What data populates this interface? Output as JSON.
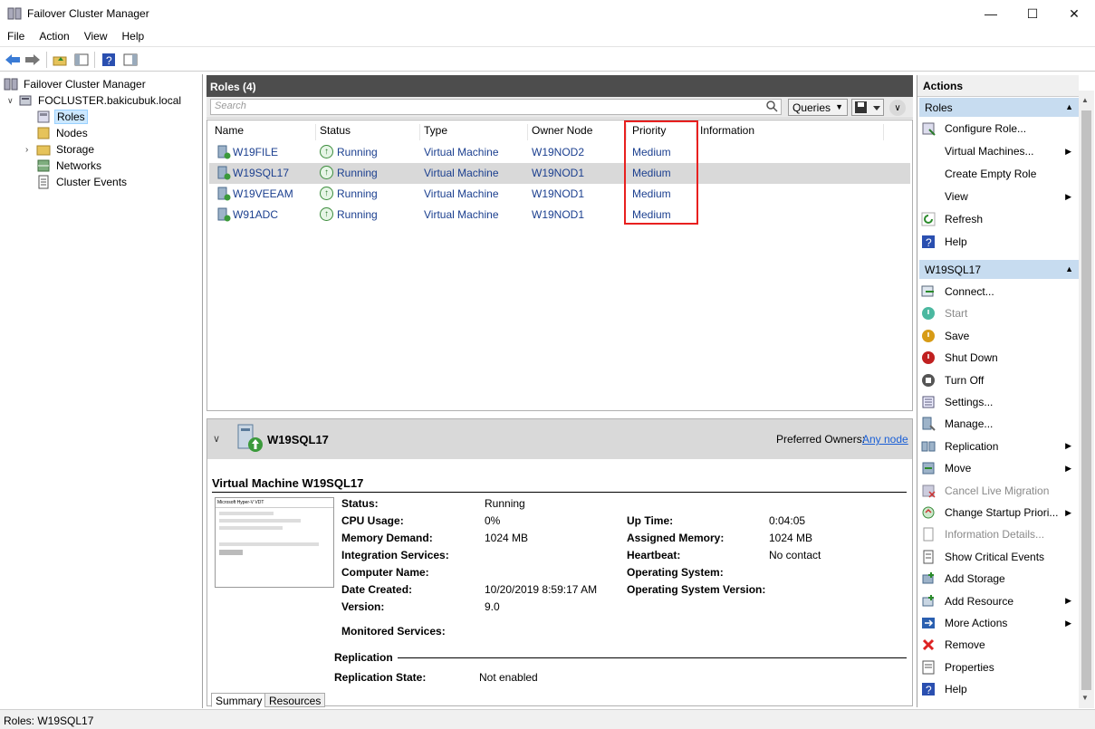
{
  "window": {
    "title": "Failover Cluster Manager",
    "minimize": "—",
    "maximize": "☐",
    "close": "✕"
  },
  "menu": [
    "File",
    "Action",
    "View",
    "Help"
  ],
  "tree": {
    "root": "Failover Cluster Manager",
    "cluster": "FOCLUSTER.bakicubuk.local",
    "items": [
      "Roles",
      "Nodes",
      "Storage",
      "Networks",
      "Cluster Events"
    ]
  },
  "roles_panel": {
    "title": "Roles (4)",
    "search_placeholder": "Search",
    "queries_label": "Queries",
    "columns": [
      "Name",
      "Status",
      "Type",
      "Owner Node",
      "Priority",
      "Information"
    ],
    "rows": [
      {
        "name": "W19FILE",
        "status": "Running",
        "type": "Virtual Machine",
        "owner": "W19NOD2",
        "priority": "Medium",
        "info": ""
      },
      {
        "name": "W19SQL17",
        "status": "Running",
        "type": "Virtual Machine",
        "owner": "W19NOD1",
        "priority": "Medium",
        "info": ""
      },
      {
        "name": "W19VEEAM",
        "status": "Running",
        "type": "Virtual Machine",
        "owner": "W19NOD1",
        "priority": "Medium",
        "info": ""
      },
      {
        "name": "W91ADC",
        "status": "Running",
        "type": "Virtual Machine",
        "owner": "W19NOD1",
        "priority": "Medium",
        "info": ""
      }
    ],
    "selected_row": 1
  },
  "detail": {
    "name": "W19SQL17",
    "preferred_owners_label": "Preferred Owners:",
    "preferred_owners_link": "Any node",
    "vm_title": "Virtual Machine W19SQL17",
    "left_labels": {
      "status": "Status:",
      "cpu": "CPU Usage:",
      "mem_demand": "Memory Demand:",
      "integration": "Integration Services:",
      "computer": "Computer Name:",
      "date_created": "Date Created:",
      "version": "Version:",
      "monitored": "Monitored Services:"
    },
    "left_values": {
      "status": "Running",
      "cpu": "0%",
      "mem_demand": "1024 MB",
      "integration": "",
      "computer": "",
      "date_created": "10/20/2019 8:59:17 AM",
      "version": "9.0",
      "monitored": ""
    },
    "right_labels": {
      "uptime": "Up Time:",
      "assigned": "Assigned Memory:",
      "heartbeat": "Heartbeat:",
      "os": "Operating System:",
      "os_version": "Operating System Version:"
    },
    "right_values": {
      "uptime": "0:04:05",
      "assigned": "1024 MB",
      "heartbeat": "No contact",
      "os": "",
      "os_version": ""
    },
    "replication_header": "Replication",
    "replication_label": "Replication State:",
    "replication_value": "Not enabled",
    "tabs": [
      "Summary",
      "Resources"
    ]
  },
  "actions": {
    "header": "Actions",
    "section1": "Roles",
    "roles_items": [
      {
        "label": "Configure Role...",
        "icon": "configure-role-icon",
        "submenu": false,
        "disabled": false
      },
      {
        "label": "Virtual Machines...",
        "icon": "",
        "submenu": true,
        "disabled": false
      },
      {
        "label": "Create Empty Role",
        "icon": "",
        "submenu": false,
        "disabled": false
      },
      {
        "label": "View",
        "icon": "",
        "submenu": true,
        "disabled": false
      },
      {
        "label": "Refresh",
        "icon": "refresh-icon",
        "submenu": false,
        "disabled": false
      },
      {
        "label": "Help",
        "icon": "help-icon",
        "submenu": false,
        "disabled": false
      }
    ],
    "section2": "W19SQL17",
    "vm_items": [
      {
        "label": "Connect...",
        "icon": "connect-icon",
        "submenu": false,
        "disabled": false
      },
      {
        "label": "Start",
        "icon": "start-icon",
        "submenu": false,
        "disabled": true
      },
      {
        "label": "Save",
        "icon": "save-icon",
        "submenu": false,
        "disabled": false
      },
      {
        "label": "Shut Down",
        "icon": "shutdown-icon",
        "submenu": false,
        "disabled": false
      },
      {
        "label": "Turn Off",
        "icon": "turn-off-icon",
        "submenu": false,
        "disabled": false
      },
      {
        "label": "Settings...",
        "icon": "settings-icon",
        "submenu": false,
        "disabled": false
      },
      {
        "label": "Manage...",
        "icon": "manage-icon",
        "submenu": false,
        "disabled": false
      },
      {
        "label": "Replication",
        "icon": "replication-icon",
        "submenu": true,
        "disabled": false
      },
      {
        "label": "Move",
        "icon": "move-icon",
        "submenu": true,
        "disabled": false
      },
      {
        "label": "Cancel Live Migration",
        "icon": "cancel-migration-icon",
        "submenu": false,
        "disabled": true
      },
      {
        "label": "Change Startup Priori...",
        "icon": "startup-priority-icon",
        "submenu": true,
        "disabled": false
      },
      {
        "label": "Information Details...",
        "icon": "info-details-icon",
        "submenu": false,
        "disabled": true
      },
      {
        "label": "Show Critical Events",
        "icon": "critical-events-icon",
        "submenu": false,
        "disabled": false
      },
      {
        "label": "Add Storage",
        "icon": "add-storage-icon",
        "submenu": false,
        "disabled": false
      },
      {
        "label": "Add Resource",
        "icon": "add-resource-icon",
        "submenu": true,
        "disabled": false
      },
      {
        "label": "More Actions",
        "icon": "more-actions-icon",
        "submenu": true,
        "disabled": false
      },
      {
        "label": "Remove",
        "icon": "remove-icon",
        "submenu": false,
        "disabled": false
      },
      {
        "label": "Properties",
        "icon": "properties-icon",
        "submenu": false,
        "disabled": false
      },
      {
        "label": "Help",
        "icon": "help-icon",
        "submenu": false,
        "disabled": false
      }
    ]
  },
  "statusbar": {
    "text": "Roles:  W19SQL17"
  },
  "thumbnail": {
    "title": "Microsoft Hyper-V VDT"
  },
  "colors": {
    "link": "#1b3f8f",
    "highlight": "#e8201f",
    "section": "#c7dcf0"
  }
}
